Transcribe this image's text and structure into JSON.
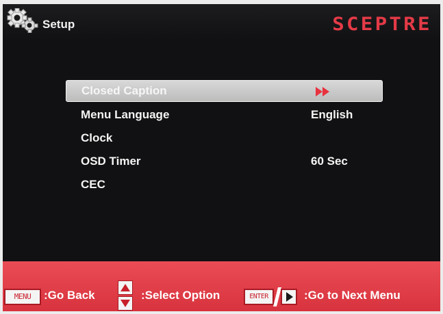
{
  "header": {
    "title": "Setup",
    "brand": "SCEPTRE",
    "icon": "gear-icon"
  },
  "menu": {
    "items": [
      {
        "label": "Closed Caption",
        "value": "",
        "selected": true,
        "icon": "fast-forward-icon"
      },
      {
        "label": "Menu Language",
        "value": "English",
        "selected": false
      },
      {
        "label": "Clock",
        "value": "",
        "selected": false
      },
      {
        "label": "OSD Timer",
        "value": "60 Sec",
        "selected": false
      },
      {
        "label": "CEC",
        "value": "",
        "selected": false
      }
    ]
  },
  "footer": {
    "menu_key": "MENU",
    "go_back": ":Go Back",
    "select_option": ":Select Option",
    "enter_key": "ENTER",
    "next_menu": ":Go to Next Menu"
  },
  "colors": {
    "background": "#111113",
    "brand_red": "#e53a47",
    "footer_red": "#e0424c",
    "highlight": "#c8c8c8",
    "text": "#f4f4f4"
  }
}
